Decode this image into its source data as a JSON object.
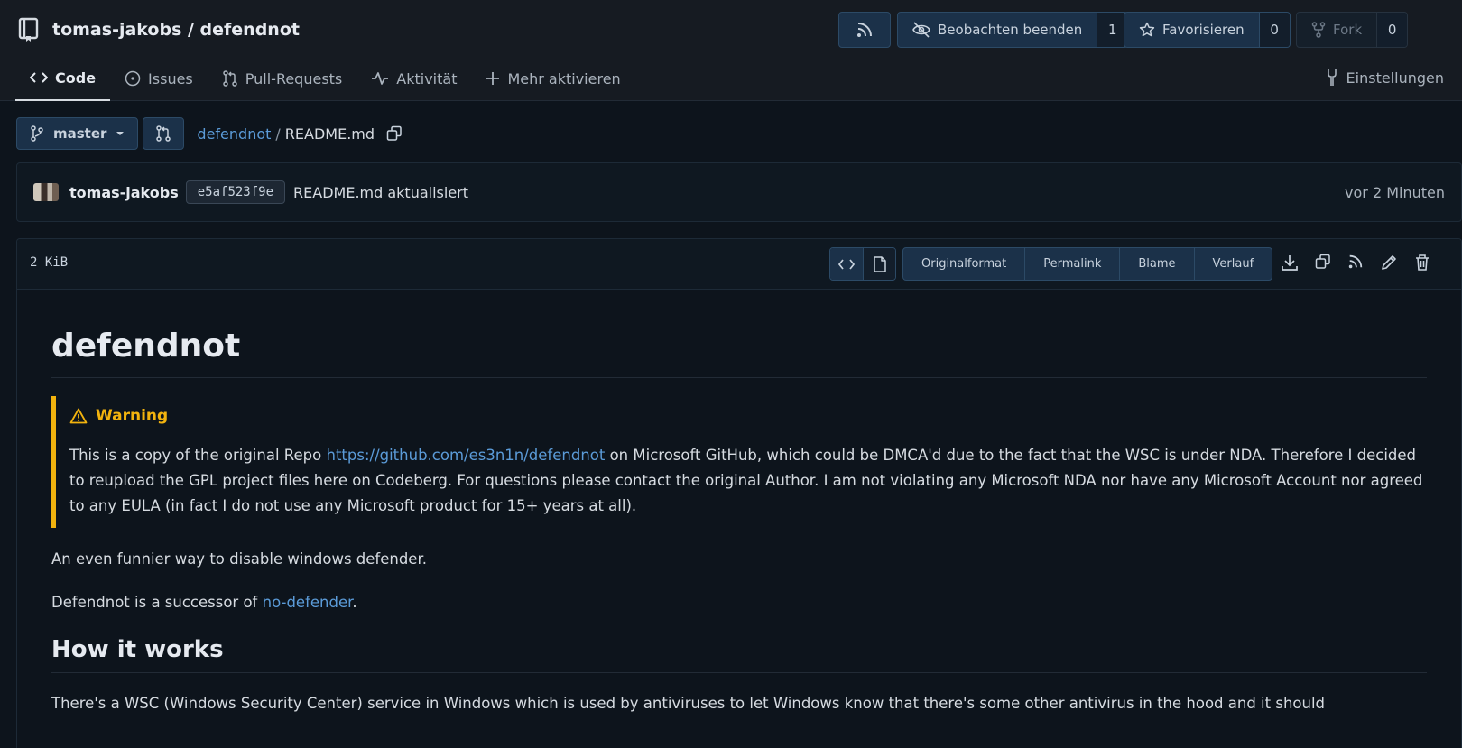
{
  "header": {
    "owner": "tomas-jakobs",
    "repo": "defendnot",
    "title": "tomas-jakobs / defendnot",
    "watch": {
      "label": "Beobachten beenden",
      "count": "1"
    },
    "star": {
      "label": "Favorisieren",
      "count": "0"
    },
    "fork": {
      "label": "Fork",
      "count": "0"
    }
  },
  "tabs": [
    {
      "label": "Code",
      "icon": "code-icon",
      "active": true
    },
    {
      "label": "Issues",
      "icon": "issues-icon"
    },
    {
      "label": "Pull-Requests",
      "icon": "pull-request-icon"
    },
    {
      "label": "Aktivität",
      "icon": "activity-icon"
    },
    {
      "label": "Mehr aktivieren",
      "icon": "plus-icon"
    }
  ],
  "settings_label": "Einstellungen",
  "branch": "master",
  "breadcrumb": {
    "repo": "defendnot",
    "separator": "/",
    "file": "README.md"
  },
  "commit": {
    "author": "tomas-jakobs",
    "sha": "e5af523f9e",
    "message": "README.md aktualisiert",
    "time": "vor 2 Minuten"
  },
  "file": {
    "size": "2 KiB",
    "actions": [
      "Originalformat",
      "Permalink",
      "Blame",
      "Verlauf"
    ]
  },
  "readme": {
    "h1": "defendnot",
    "warning_title": "Warning",
    "warning_pre": "This is a copy of the original Repo ",
    "warning_link": "https://github.com/es3n1n/defendnot",
    "warning_post": " on Microsoft GitHub, which could be DMCA'd due to the fact that the WSC is under NDA. Therefore I decided to reupload the GPL project files here on Codeberg. For questions please contact the original Author. I am not violating any Microsoft NDA nor have any Microsoft Account nor agreed to any EULA (in fact I do not use any Microsoft product for 15+ years at all).",
    "para1": "An even funnier way to disable windows defender.",
    "para2_pre": "Defendnot is a successor of ",
    "para2_link": "no-defender",
    "para2_post": ".",
    "h2": "How it works",
    "para3": "There's a WSC (Windows Security Center) service in Windows which is used by antiviruses to let Windows know that there's some other antivirus in the hood and it should"
  },
  "colors": {
    "accent": "#5b9bd8",
    "warning": "#f2b30e",
    "background": "#0d141c"
  }
}
